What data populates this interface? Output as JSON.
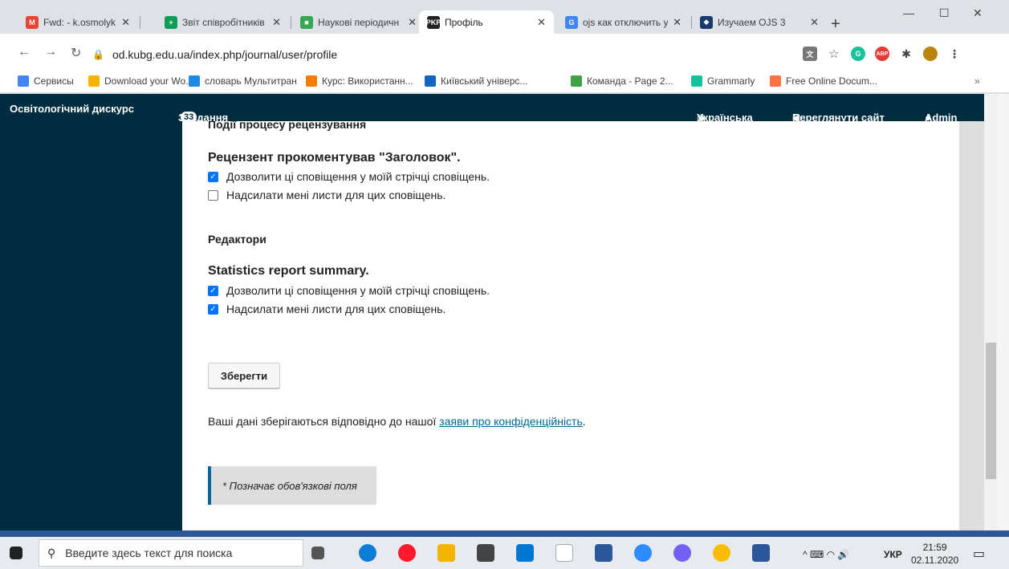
{
  "browser": {
    "tabs": [
      {
        "title": "Fwd: - k.osmolyk@k",
        "fav_color": "#ea4335",
        "fav_text": "M"
      },
      {
        "title": "Звіт співробітників",
        "fav_color": "#0f9d58",
        "fav_text": "+"
      },
      {
        "title": "Наукові періодичн",
        "fav_color": "#34a853",
        "fav_text": "■"
      },
      {
        "title": "Профіль",
        "fav_color": "#222222",
        "fav_text": "PKP"
      },
      {
        "title": "ojs как отключить у",
        "fav_color": "#4285f4",
        "fav_text": "G"
      },
      {
        "title": "Изучаем OJS 3",
        "fav_color": "#1a3a6b",
        "fav_text": "◆"
      }
    ],
    "url": "od.kubg.edu.ua/index.php/journal/user/profile",
    "bookmarks": [
      {
        "label": "Сервисы",
        "color": "#4285f4"
      },
      {
        "label": "Download your Wo...",
        "color": "#f4b400"
      },
      {
        "label": "словарь Мультитран",
        "color": "#1e88e5"
      },
      {
        "label": "Курс: Використанн...",
        "color": "#f57c00"
      },
      {
        "label": "Київський універс...",
        "color": "#1565c0"
      },
      {
        "label": "Команда - Page 2...",
        "color": "#43a047"
      },
      {
        "label": "Grammarly",
        "color": "#15c39a"
      },
      {
        "label": "Free Online Docum...",
        "color": "#ff7043"
      }
    ]
  },
  "site": {
    "name": "Освітологічний дискурс",
    "tasks_label": "Завдання",
    "tasks_count": "33",
    "language": "Українська",
    "view_site": "Переглянути сайт",
    "user": "Admin"
  },
  "content": {
    "section_top": "Події процесу рецензування",
    "item1_title": "Рецензент прокоментував \"Заголовок\".",
    "item1_opt1": "Дозволити ці сповіщення у моїй стрічці сповіщень.",
    "item1_opt2": "Надсилати мені листи для цих сповіщень.",
    "section_editors": "Редактори",
    "item2_title": "Statistics report summary.",
    "item2_opt1": "Дозволити ці сповіщення у моїй стрічці сповіщень.",
    "item2_opt2": "Надсилати мені листи для цих сповіщень.",
    "save": "Зберегти",
    "privacy_prefix": "Ваші дані зберігаються відповідно до нашої ",
    "privacy_link": "заяви про конфіденційність",
    "privacy_suffix": ".",
    "required_note": "* Позначає обов'язкові поля"
  },
  "taskbar": {
    "search_placeholder": "Введите здесь текст для поиска",
    "lang": "УКР",
    "time": "21:59",
    "date": "02.11.2020"
  }
}
